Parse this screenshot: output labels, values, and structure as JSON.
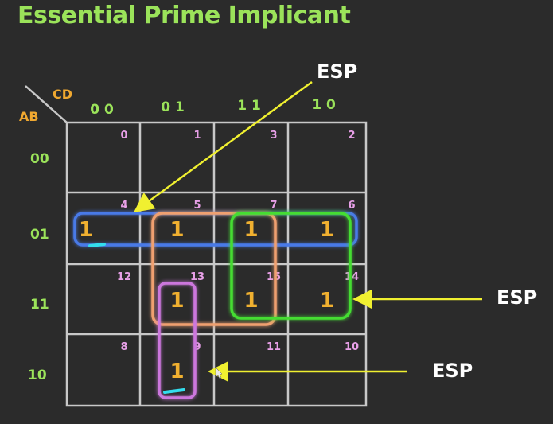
{
  "title": "Essential Prime Implicant",
  "kmap": {
    "row_var": "AB",
    "col_var": "CD",
    "col_labels": [
      "0 0",
      "0 1",
      "1 1",
      "1 0"
    ],
    "row_labels": [
      "00",
      "01",
      "11",
      "10"
    ],
    "cell_indices": [
      [
        "0",
        "1",
        "3",
        "2"
      ],
      [
        "4",
        "5",
        "7",
        "6"
      ],
      [
        "12",
        "13",
        "15",
        "14"
      ],
      [
        "8",
        "9",
        "11",
        "10"
      ]
    ],
    "cell_values": [
      [
        "",
        "",
        "",
        ""
      ],
      [
        "1",
        "1",
        "1",
        "1"
      ],
      [
        "",
        "1",
        "1",
        "1"
      ],
      [
        "",
        "1",
        "",
        ""
      ]
    ]
  },
  "groups": [
    {
      "name": "row-01-group",
      "color": "#4a7ae8",
      "rows": [
        1,
        1
      ],
      "cols": [
        0,
        3
      ]
    },
    {
      "name": "quad-5-7-13-15-group",
      "color": "#f0a070",
      "rows": [
        1,
        2
      ],
      "cols": [
        1,
        2
      ]
    },
    {
      "name": "quad-7-6-15-14-group",
      "color": "#44dd33",
      "rows": [
        1,
        2
      ],
      "cols": [
        2,
        3
      ]
    },
    {
      "name": "pair-13-9-group",
      "color": "#cc77dd",
      "rows": [
        2,
        3
      ],
      "cols": [
        1,
        1
      ]
    }
  ],
  "annotations": [
    {
      "label": "ESP",
      "target": "cell 4"
    },
    {
      "label": "ESP",
      "target": "green group"
    },
    {
      "label": "ESP",
      "target": "cell 9"
    }
  ],
  "colors": {
    "title": "#9be35a",
    "var_label": "#f0a830",
    "axis_label": "#9be35a",
    "cell_index": "#e8a0e8",
    "one": "#f0b030",
    "grid": "#c8c8c8",
    "arrow": "#f0f030",
    "underline": "#33ddee"
  }
}
